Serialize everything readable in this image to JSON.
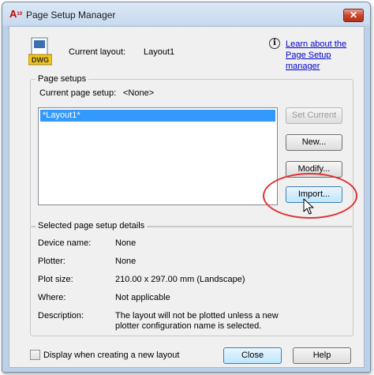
{
  "window": {
    "title": "Page Setup Manager",
    "app_icon_text": "A",
    "app_icon_sub": "10",
    "close_glyph": "✕"
  },
  "header": {
    "icon_label": "DWG",
    "current_layout_label": "Current layout:",
    "current_layout_value": "Layout1",
    "info_glyph": "i",
    "learn_link_line1": "Learn about the",
    "learn_link_line2": "Page Setup manager"
  },
  "page_setups": {
    "group_label": "Page setups",
    "current_label": "Current page setup:",
    "current_value": "<None>",
    "list_items": [
      "*Layout1*"
    ],
    "buttons": {
      "set_current": "Set Current",
      "new": "New...",
      "modify": "Modify...",
      "import": "Import..."
    }
  },
  "details": {
    "group_label": "Selected page setup details",
    "rows": [
      {
        "label": "Device name:",
        "value": "None"
      },
      {
        "label": "Plotter:",
        "value": "None"
      },
      {
        "label": "Plot size:",
        "value": "210.00 x 297.00 mm (Landscape)"
      },
      {
        "label": "Where:",
        "value": "Not applicable"
      },
      {
        "label": "Description:",
        "value": "The layout will not be plotted unless a new plotter configuration name is selected."
      }
    ]
  },
  "footer": {
    "checkbox_label": "Display when creating a new layout",
    "close": "Close",
    "help": "Help"
  },
  "colors": {
    "selection": "#3399ff",
    "annotation_circle": "#e03030",
    "link": "#0000d0"
  }
}
